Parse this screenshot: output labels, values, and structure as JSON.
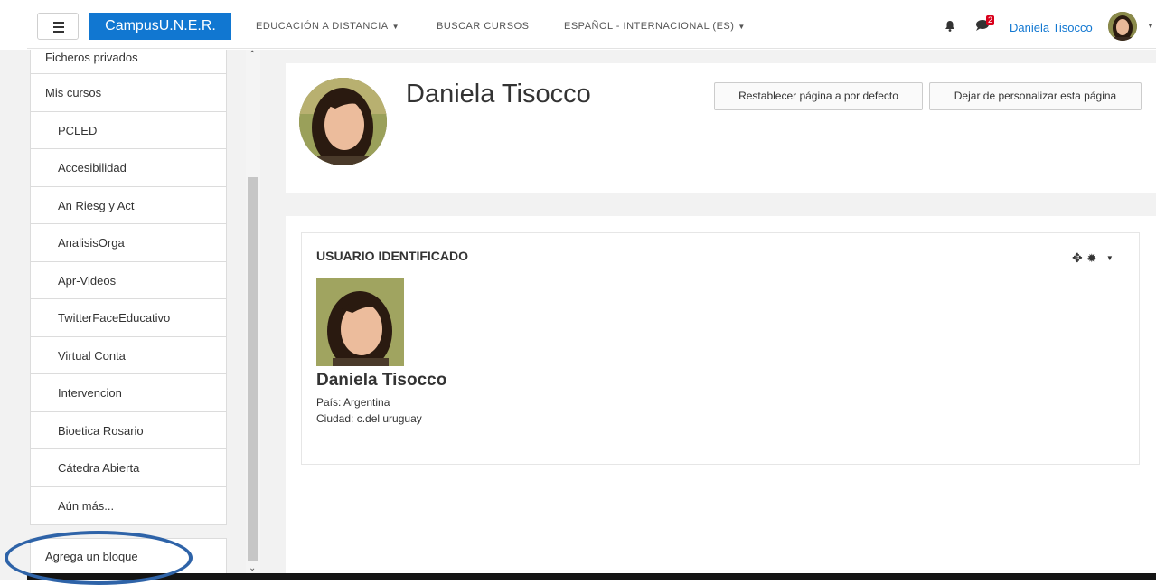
{
  "navbar": {
    "brand": "CampusU.N.E.R.",
    "links": [
      {
        "label": "EDUCACIÓN A DISTANCIA",
        "has_caret": true
      },
      {
        "label": "BUSCAR CURSOS",
        "has_caret": false
      },
      {
        "label": "ESPAÑOL - INTERNACIONAL (ES)",
        "has_caret": true
      }
    ],
    "notification_icon": "bell-icon",
    "messages_icon": "chat-bubble-icon",
    "message_badge": "2",
    "user_name": "Daniela Tisocco",
    "accent_color": "#1177d1"
  },
  "drawer": {
    "items": [
      {
        "label": "Ficheros privados"
      },
      {
        "label": "Mis cursos"
      },
      {
        "label": "PCLED"
      },
      {
        "label": "Accesibilidad"
      },
      {
        "label": "An Riesg y Act"
      },
      {
        "label": "AnalisisOrga"
      },
      {
        "label": "Apr-Videos"
      },
      {
        "label": "TwitterFaceEducativo"
      },
      {
        "label": "Virtual Conta"
      },
      {
        "label": "Intervencion"
      },
      {
        "label": "Bioetica Rosario"
      },
      {
        "label": "Cátedra Abierta"
      },
      {
        "label": "Aún más..."
      }
    ],
    "add_block": "Agrega un bloque"
  },
  "header": {
    "title": "Daniela Tisocco",
    "reset_button": "Restablecer página a por defecto",
    "stop_customising_button": "Dejar de personalizar esta página"
  },
  "block": {
    "title": "USUARIO IDENTIFICADO",
    "move_icon": "move-icon",
    "settings_icon": "gear-icon",
    "name": "Daniela Tisocco",
    "country": "País: Argentina",
    "city": "Ciudad: c.del uruguay"
  },
  "colors": {
    "annotation": "#2e63a8",
    "badge": "#d9001b"
  }
}
